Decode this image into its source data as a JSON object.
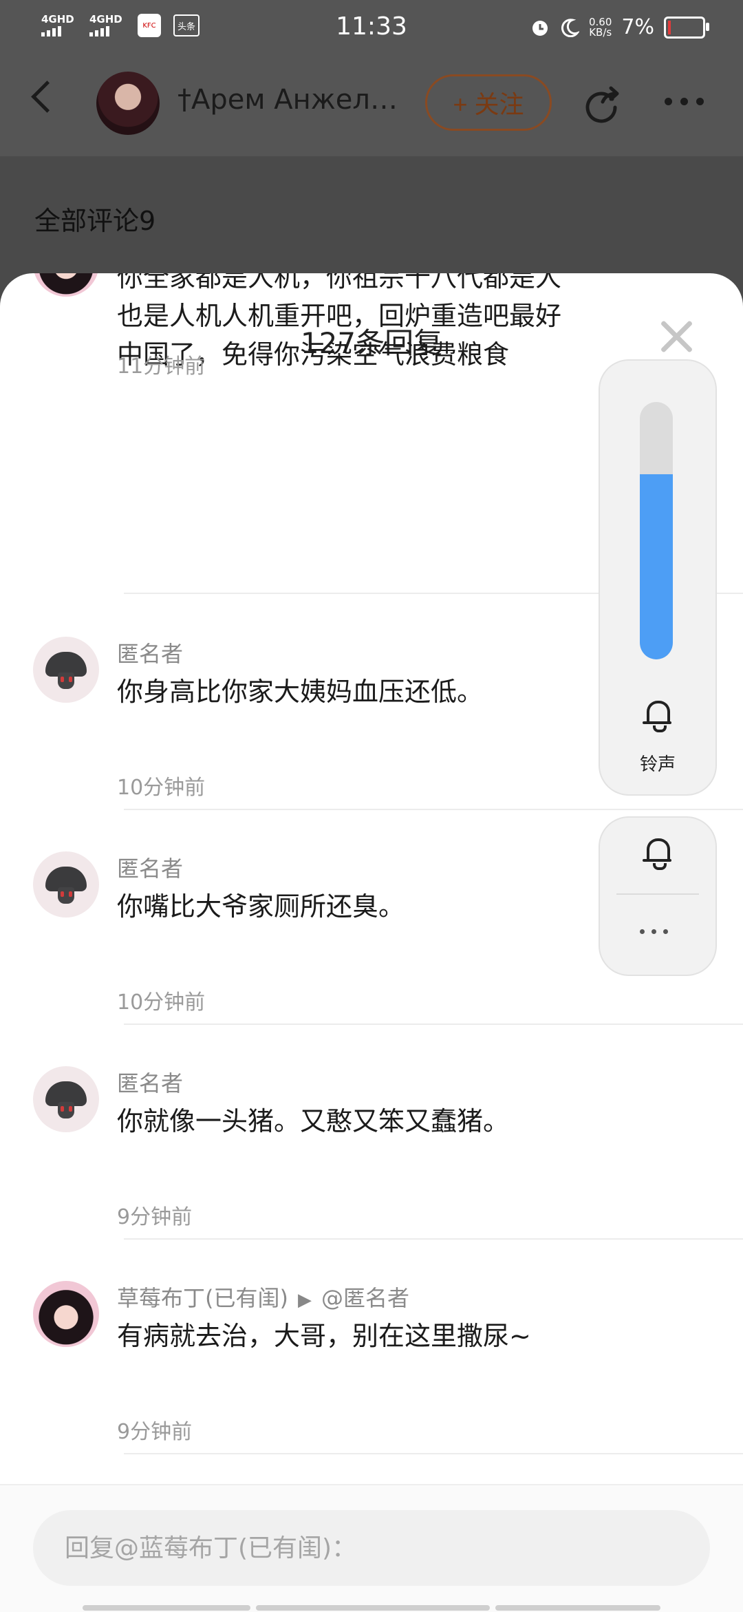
{
  "status_bar": {
    "signal1": "4GHD",
    "signal2": "4GHD",
    "app_badge": "KFC",
    "toutiao": "头条",
    "time": "11:33",
    "net_speed": "0.60",
    "net_unit": "KB/s",
    "battery_percent": "7%",
    "battery_level": 0.07
  },
  "header": {
    "username": "†Арем Анжел…",
    "follow_label": "+ 关注",
    "all_comments": "全部评论9"
  },
  "sheet": {
    "title": "127条回复",
    "comments": [
      {
        "name": "",
        "lines": [
          "你全家都是人机，你祖宗十八代都是人",
          "也是人机人机重开吧，回炉重造吧最好",
          "中国了，免得你污染空气浪费粮食"
        ],
        "time": "11分钟前"
      },
      {
        "name": "匿名者",
        "text": "你身高比你家大姨妈血压还低。",
        "time": "10分钟前"
      },
      {
        "name": "匿名者",
        "text": "你嘴比大爷家厕所还臭。",
        "time": "10分钟前"
      },
      {
        "name": "匿名者",
        "text": "你就像一头猪。又憨又笨又蠢猪。",
        "time": "9分钟前"
      },
      {
        "name": "草莓布丁(已有闺)",
        "reply_to": "@匿名者",
        "text": "有病就去治，大哥，别在这里撒尿~",
        "time": "9分钟前"
      }
    ]
  },
  "volume_overlay": {
    "level": 0.72,
    "ring_label": "铃声",
    "accent": "#4d9ef5"
  },
  "reply_input": {
    "placeholder": "回复@蓝莓布丁(已有闺)："
  }
}
